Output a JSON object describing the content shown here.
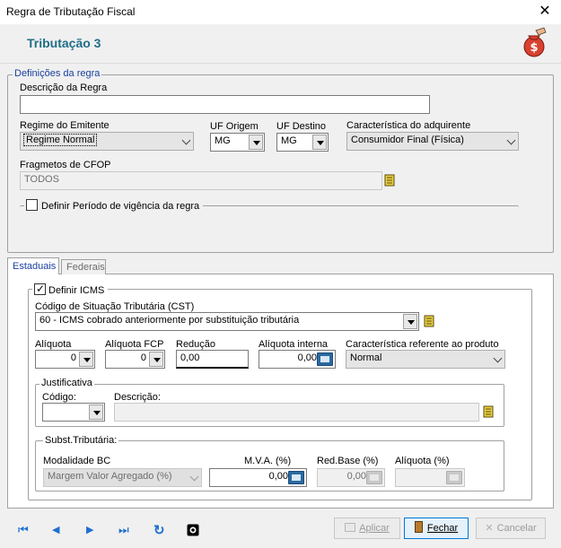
{
  "window": {
    "title": "Regra de Tributação Fiscal",
    "close_glyph": "✕"
  },
  "header": {
    "title": "Tributação 3"
  },
  "definicoes": {
    "legend": "Definições da regra",
    "descricao_label": "Descrição da Regra",
    "descricao_value": "",
    "regime_label": "Regime do Emitente",
    "regime_value": "Regime Normal",
    "uf_origem_label": "UF Origem",
    "uf_origem_value": "MG",
    "uf_destino_label": "UF Destino",
    "uf_destino_value": "MG",
    "caracteristica_label": "Característica do adquirente",
    "caracteristica_value": "Consumidor Final (Física)",
    "cfop_label": "Fragmetos de CFOP",
    "cfop_value": "TODOS",
    "periodo_label": "Definir Período de vigência da regra"
  },
  "tabs": [
    {
      "label": "Estaduais",
      "active": true
    },
    {
      "label": "Federais",
      "active": false
    }
  ],
  "estaduais": {
    "definir_icms_label": "Definir ICMS",
    "definir_icms_checked": true,
    "cst_label": "Código de Situação Tributária (CST)",
    "cst_value": "60 - ICMS cobrado anteriormente por substituição tributária",
    "aliquota_label": "Alíquota",
    "aliquota_value": "0",
    "aliquota_fcp_label": "Alíquota FCP",
    "aliquota_fcp_value": "0",
    "reducao_label": "Redução",
    "reducao_value": "0,00",
    "aliquota_interna_label": "Alíquota interna",
    "aliquota_interna_value": "0,00",
    "carac_produto_label": "Característica referente ao produto",
    "carac_produto_value": "Normal",
    "justificativa": {
      "legend": "Justificativa",
      "codigo_label": "Código:",
      "codigo_value": "",
      "descricao_label": "Descrição:",
      "descricao_value": ""
    },
    "subst": {
      "legend": "Subst.Tributária:",
      "modalidade_label": "Modalidade BC",
      "modalidade_value": "Margem Valor Agregado (%)",
      "mva_label": "M.V.A. (%)",
      "mva_value": "0,00",
      "redbase_label": "Red.Base (%)",
      "redbase_value": "0,00",
      "aliquota_label": "Alíquota (%)",
      "aliquota_value": ""
    }
  },
  "footer": {
    "nav_first": "⏮",
    "nav_prev": "◀",
    "nav_next": "▶",
    "nav_last": "⏭",
    "nav_refresh": "↻",
    "aplicar_label": "Aplicar",
    "fechar_label": "Fechar",
    "cancelar_label": "Cancelar"
  },
  "colors": {
    "accent": "#1f6f87",
    "link": "#1f6fd0",
    "primary_border": "#0078d7"
  }
}
